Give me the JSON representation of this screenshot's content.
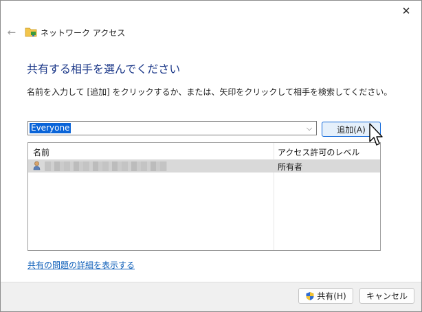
{
  "window": {
    "title": "ネットワーク アクセス",
    "close_glyph": "✕",
    "back_glyph": "←"
  },
  "main": {
    "heading": "共有する相手を選んでください",
    "instruction": "名前を入力して [追加] をクリックするか、または、矢印をクリックして相手を検索してください。",
    "combo": {
      "value": "Everyone",
      "arrow_glyph": "⌵"
    },
    "add_button_label": "追加(A)",
    "grid": {
      "columns": [
        "名前",
        "アクセス許可のレベル"
      ],
      "rows": [
        {
          "permission": "所有者"
        }
      ]
    },
    "help_link": "共有の問題の詳細を表示する"
  },
  "footer": {
    "share_label": "共有(H)",
    "cancel_label": "キャンセル"
  },
  "icons": {
    "app": "network-folder-icon",
    "user": "user-icon",
    "shield": "uac-shield-icon",
    "cursor": "mouse-cursor-icon"
  },
  "colors": {
    "heading": "#1e3a8a",
    "selection": "#0a64d8",
    "link": "#0a5cb8",
    "focused_button": "#e5f0fb"
  }
}
